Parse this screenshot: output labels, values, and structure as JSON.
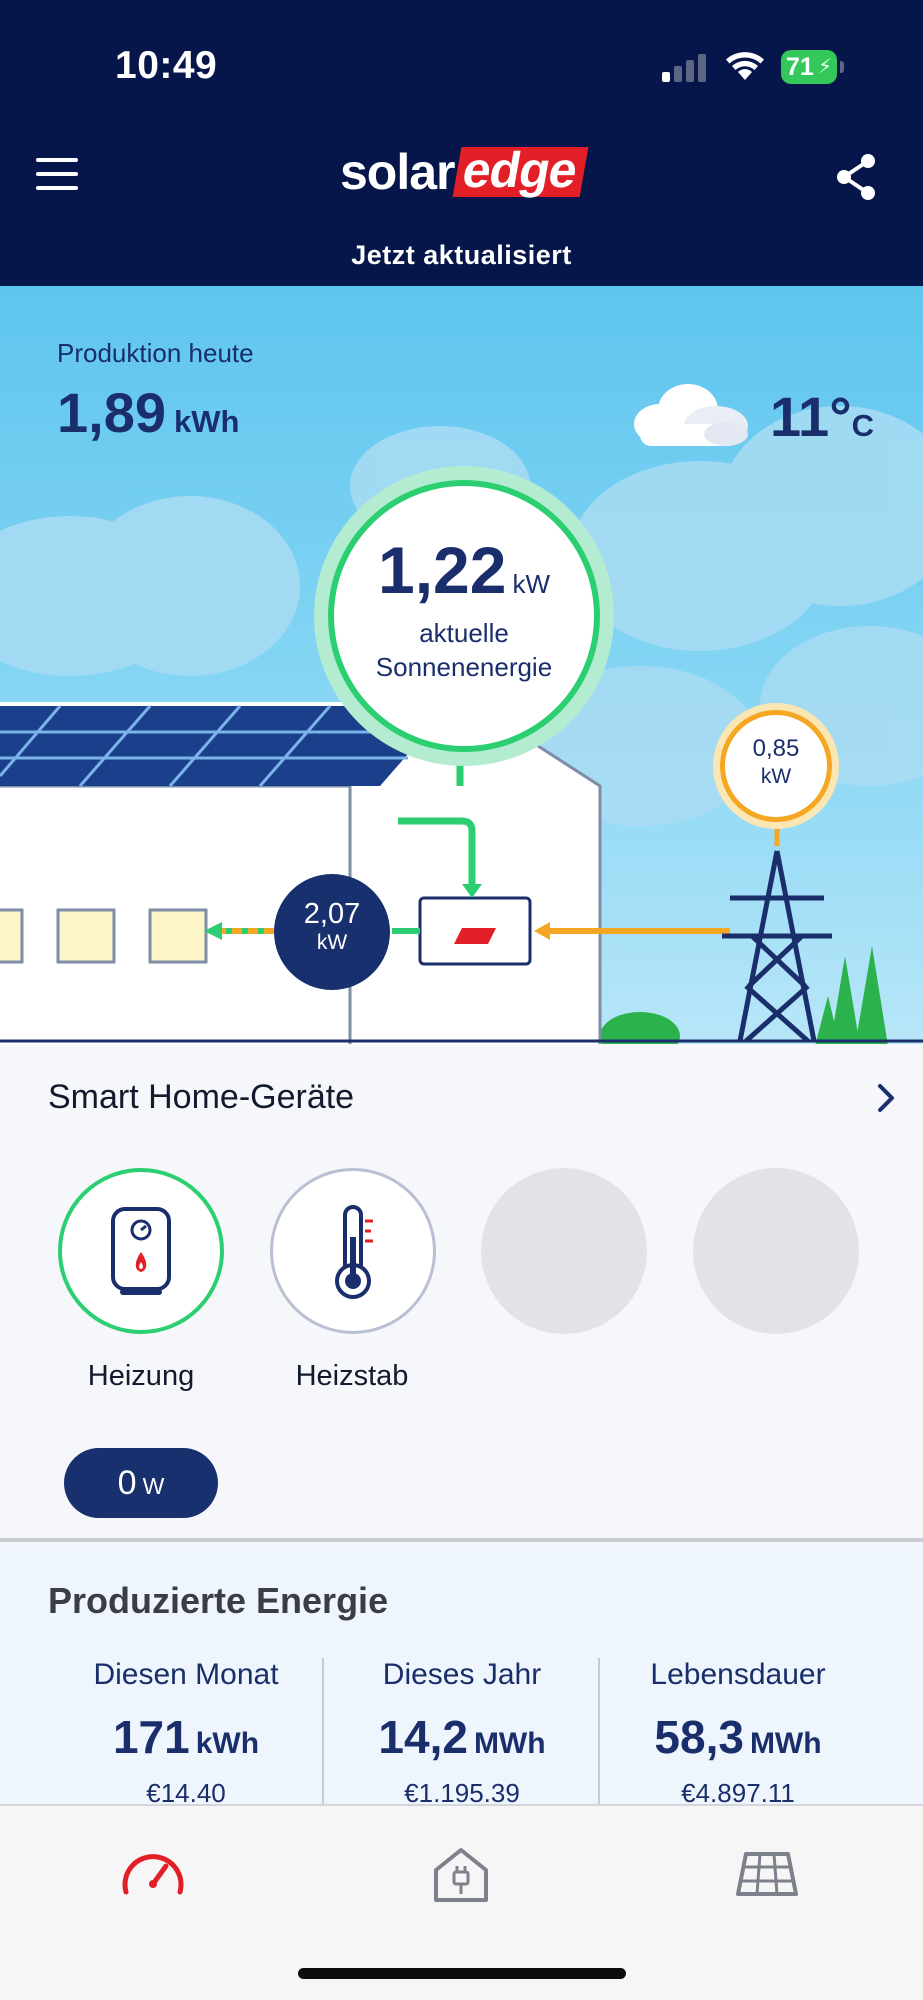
{
  "status_bar": {
    "time": "10:49",
    "battery": "71"
  },
  "header": {
    "logo_solar": "solar",
    "logo_edge": "edge",
    "update_status": "Jetzt aktualisiert"
  },
  "hero": {
    "production_label": "Produktion heute",
    "production_value": "1,89",
    "production_unit": "kWh",
    "temperature_value": "11°",
    "temperature_unit": "C",
    "solar_power_value": "1,22",
    "solar_power_unit": "kW",
    "solar_label_line1": "aktuelle",
    "solar_label_line2": "Sonnenenergie",
    "grid_value": "0,85",
    "grid_unit": "kW",
    "home_value": "2,07",
    "home_unit": "kW",
    "colors": {
      "solar": "#2bcf71",
      "grid": "#f5a623",
      "home": "#18306e"
    }
  },
  "smart_home": {
    "title": "Smart Home-Geräte",
    "devices": [
      {
        "label": "Heizung",
        "icon": "water-heater-icon",
        "active": true
      },
      {
        "label": "Heizstab",
        "icon": "thermometer-icon",
        "active": false
      }
    ],
    "power_value": "0",
    "power_unit": "W"
  },
  "energy": {
    "title": "Produzierte Energie",
    "columns": [
      {
        "label": "Diesen Monat",
        "value": "171",
        "unit": "kWh",
        "money": "€14.40"
      },
      {
        "label": "Dieses Jahr",
        "value": "14,2",
        "unit": "MWh",
        "money": "€1.195.39"
      },
      {
        "label": "Lebensdauer",
        "value": "58,3",
        "unit": "MWh",
        "money": "€4.897.11"
      }
    ]
  },
  "tabs": [
    {
      "icon": "dashboard-gauge-icon",
      "active": true
    },
    {
      "icon": "house-plug-icon",
      "active": false
    },
    {
      "icon": "solar-panel-icon",
      "active": false
    }
  ]
}
